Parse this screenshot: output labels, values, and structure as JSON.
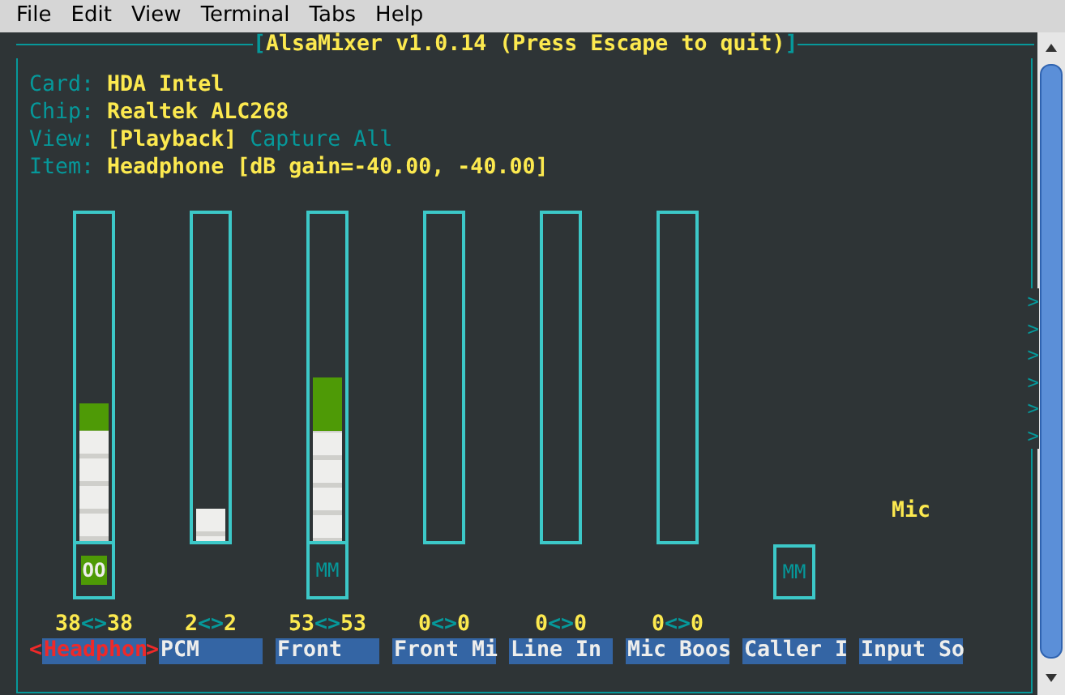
{
  "menu": [
    "File",
    "Edit",
    "View",
    "Terminal",
    "Tabs",
    "Help"
  ],
  "title": {
    "text": "AlsaMixer v1.0.14 (Press Escape to quit)",
    "brackets": [
      "[",
      "]"
    ]
  },
  "info": [
    {
      "label": "Card:",
      "value": "HDA Intel"
    },
    {
      "label": "Chip:",
      "value": "Realtek ALC268"
    },
    {
      "label": "Item:",
      "value": "Headphone [dB gain=-40.00, -40.00]"
    }
  ],
  "view": {
    "label": "View:",
    "options": [
      {
        "text": "[Playback]",
        "selected": true
      },
      {
        "text": "Capture",
        "selected": false
      },
      {
        "text": "All",
        "selected": false
      }
    ]
  },
  "selection_marks": [
    "<",
    ">"
  ],
  "channels": [
    {
      "kind": "slider",
      "name": "Headphon",
      "selected": true,
      "level": 0.42,
      "switch": {
        "text": "OO",
        "muted": false
      },
      "volume": [
        "38",
        "<>",
        "38"
      ]
    },
    {
      "kind": "slider",
      "name": "PCM",
      "selected": false,
      "level": 0.1,
      "volume": [
        "2",
        "<>",
        "2"
      ]
    },
    {
      "kind": "slider",
      "name": "Front",
      "selected": false,
      "level": 0.5,
      "switch": {
        "text": "MM",
        "muted": true
      },
      "volume": [
        "53",
        "<>",
        "53"
      ]
    },
    {
      "kind": "slider",
      "name": "Front Mi",
      "selected": false,
      "volume": [
        "0",
        "<>",
        "0"
      ]
    },
    {
      "kind": "slider",
      "name": "Line In",
      "selected": false,
      "volume": [
        "0",
        "<>",
        "0"
      ]
    },
    {
      "kind": "slider",
      "name": "Mic Boos",
      "selected": false,
      "volume": [
        "0",
        "<>",
        "0"
      ]
    },
    {
      "kind": "switch",
      "name": "Caller I",
      "selected": false,
      "switch": {
        "text": "MM",
        "muted": true
      }
    },
    {
      "kind": "enum",
      "name": "Input So",
      "selected": false,
      "value": "Mic"
    }
  ],
  "more_indicators": [
    ">",
    ">",
    ">",
    ">",
    ">",
    ">"
  ]
}
